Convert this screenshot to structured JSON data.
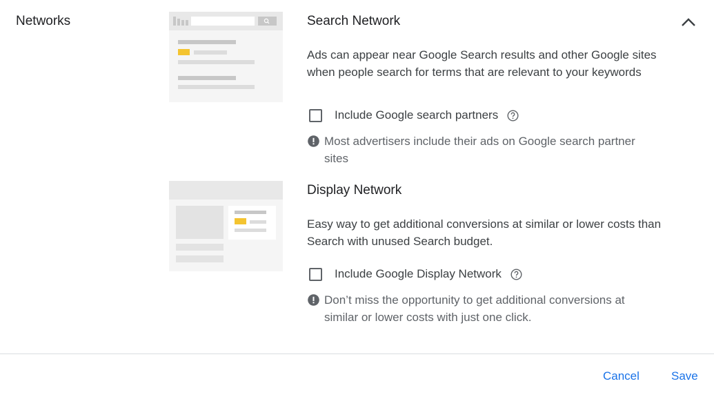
{
  "section": {
    "label": "Networks"
  },
  "search_network": {
    "title": "Search Network",
    "description": "Ads can appear near Google Search results and other Google sites when people search for terms that are relevant to your keywords",
    "checkbox_label": "Include Google search partners",
    "checked": false,
    "notice": "Most advertisers include their ads on Google search partner sites"
  },
  "display_network": {
    "title": "Display Network",
    "description": "Easy way to get additional conversions at similar or lower costs than Search with unused Search budget.",
    "checkbox_label": "Include Google Display Network",
    "checked": false,
    "notice": "Don’t miss the opportunity to get additional conversions at similar or lower costs with just one click."
  },
  "footer": {
    "cancel_label": "Cancel",
    "save_label": "Save"
  },
  "icons": {
    "collapse": "chevron-up-icon",
    "help": "help-circle-icon",
    "notice": "exclamation-circle-icon"
  },
  "colors": {
    "accent": "#1a73e8",
    "illustration_highlight": "#f4c430"
  }
}
